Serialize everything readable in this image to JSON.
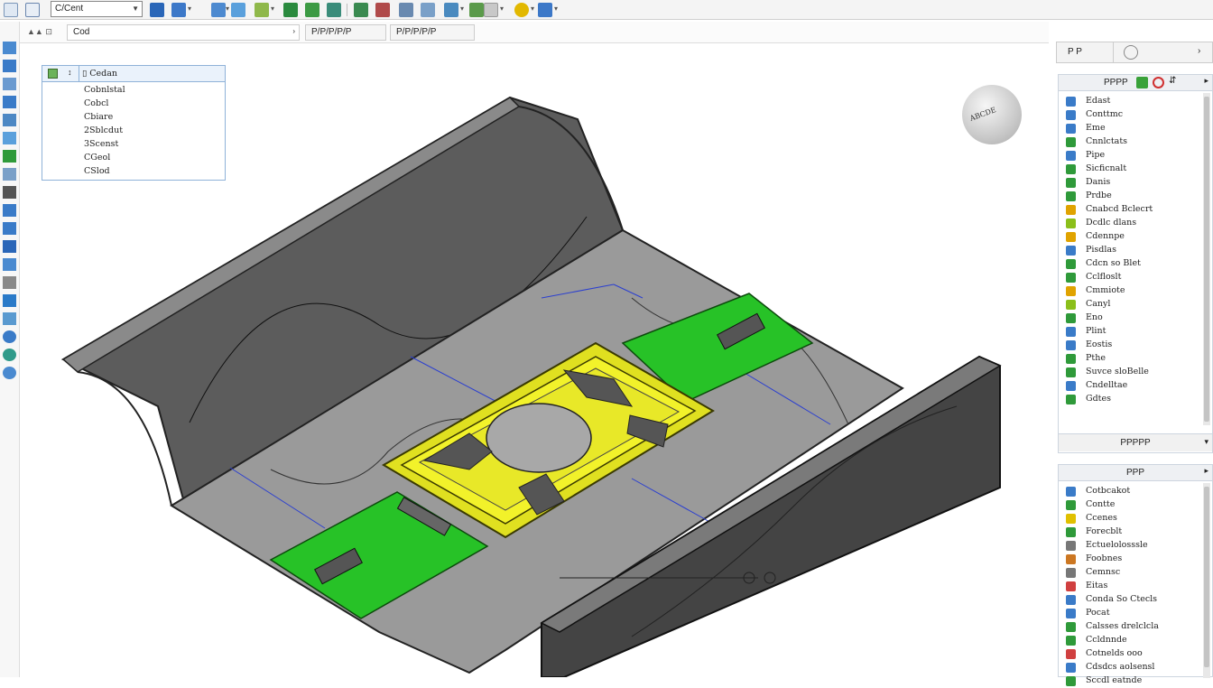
{
  "toolbar": {
    "combo_value": "C/Cent"
  },
  "subbar": {
    "view_field": "Cod",
    "btn1": "P/P/P/P/P",
    "btn2": "P/P/P/P/P"
  },
  "feature_tree": {
    "header": "Cedan",
    "items": [
      "Cobnlstal",
      "Cobcl",
      "Cbiare",
      "2Sblcdut",
      "3Scenst",
      "CGeol",
      "CSlod"
    ]
  },
  "compass": {
    "label": "ABCDE"
  },
  "right_panel_top": {
    "label": "P  P"
  },
  "panel1": {
    "title": "PPPP",
    "items": [
      {
        "label": "Edast",
        "icon": "pointer-icon",
        "color": "#3a7bc8"
      },
      {
        "label": "Conttmc",
        "icon": "line-icon",
        "color": "#3a7bc8"
      },
      {
        "label": "Eme",
        "icon": "arc-icon",
        "color": "#3a7bc8"
      },
      {
        "label": "Cnnlctats",
        "icon": "spline-icon",
        "color": "#2f9a3a"
      },
      {
        "label": "Pipe",
        "icon": "pen-icon",
        "color": "#3a7bc8"
      },
      {
        "label": "Sicficnalt",
        "icon": "shape-icon",
        "color": "#2f9a3a"
      },
      {
        "label": "Danis",
        "icon": "circle-icon",
        "color": "#2f9a3a"
      },
      {
        "label": "Prdbe",
        "icon": "brush-icon",
        "color": "#2f9a3a"
      },
      {
        "label": "Cnabcd Bclecrt",
        "icon": "lock-icon",
        "color": "#e0a300"
      },
      {
        "label": "Dcdlc dlans",
        "icon": "circle-icon",
        "color": "#8bbf1a"
      },
      {
        "label": "Cdennpe",
        "icon": "folder-icon",
        "color": "#e0a300"
      },
      {
        "label": "Pisdlas",
        "icon": "slope-icon",
        "color": "#3a7bc8"
      },
      {
        "label": "Cdcn so Blet",
        "icon": "fork-icon",
        "color": "#2f9a3a"
      },
      {
        "label": "Cclfloslt",
        "icon": "axis-icon",
        "color": "#2f9a3a"
      },
      {
        "label": "Cmmiote",
        "icon": "bag-icon",
        "color": "#e0a300"
      },
      {
        "label": "Canyl",
        "icon": "circle-icon",
        "color": "#8bbf1a"
      },
      {
        "label": "Eno",
        "icon": "flag-icon",
        "color": "#2f9a3a"
      },
      {
        "label": "Plint",
        "icon": "line-icon",
        "color": "#3a7bc8"
      },
      {
        "label": "Eostis",
        "icon": "chart-icon",
        "color": "#3a7bc8"
      },
      {
        "label": "Pthe",
        "icon": "tree-icon",
        "color": "#2f9a3a"
      },
      {
        "label": "Suvce sloBelle",
        "icon": "grid-icon",
        "color": "#2f9a3a"
      },
      {
        "label": "Cndelltae",
        "icon": "table-icon",
        "color": "#3a7bc8"
      },
      {
        "label": "Gdtes",
        "icon": "shield-icon",
        "color": "#2f9a3a"
      }
    ],
    "footer": "PPPPP"
  },
  "panel2": {
    "title": "PPP",
    "items": [
      {
        "label": "Cotbcakot",
        "icon": "info-icon",
        "color": "#3a7bc8"
      },
      {
        "label": "Contte",
        "icon": "circle-icon",
        "color": "#2f9a3a"
      },
      {
        "label": "Ccenes",
        "icon": "ring-icon",
        "color": "#e0c000"
      },
      {
        "label": "Forecblt",
        "icon": "pin-icon",
        "color": "#2f9a3a"
      },
      {
        "label": "Ectuelolosssle",
        "icon": "grid-icon",
        "color": "#777777"
      },
      {
        "label": "Foobnes",
        "icon": "chart-icon",
        "color": "#cc7722"
      },
      {
        "label": "Cemnsc",
        "icon": "cube-icon",
        "color": "#777777"
      },
      {
        "label": "Eitas",
        "icon": "arrow-icon",
        "color": "#d04040"
      },
      {
        "label": "Conda So Ctecls",
        "icon": "user-icon",
        "color": "#3a7bc8"
      },
      {
        "label": "Pocat",
        "icon": "compass-icon",
        "color": "#3a7bc8"
      },
      {
        "label": "Calsses drelclcla",
        "icon": "refresh-icon",
        "color": "#2f9a3a"
      },
      {
        "label": "Ccldnnde",
        "icon": "circle-icon",
        "color": "#2f9a3a"
      },
      {
        "label": "Cotnelds ooo",
        "icon": "box-icon",
        "color": "#d04040"
      },
      {
        "label": "Cdsdcs aolsensl",
        "icon": "tools-icon",
        "color": "#3a7bc8"
      },
      {
        "label": "Sccdl eatnde",
        "icon": "check-icon",
        "color": "#2f9a3a"
      }
    ]
  }
}
